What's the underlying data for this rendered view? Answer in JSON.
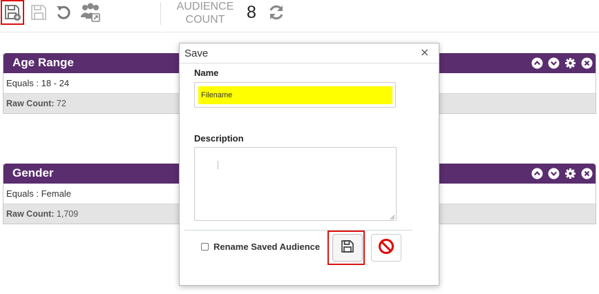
{
  "toolbar": {
    "audience_label": "AUDIENCE\nCOUNT",
    "audience_count": "8"
  },
  "panels": [
    {
      "title": "Age Range",
      "criteria": "Equals : 18 - 24",
      "raw_label": "Raw Count:",
      "raw_value": "72"
    },
    {
      "title": "Gender",
      "criteria": "Equals : Female",
      "raw_label": "Raw Count:",
      "raw_value": "1,709"
    }
  ],
  "dialog": {
    "title": "Save",
    "close_glyph": "×",
    "name_label": "Name",
    "name_value": "Filename",
    "description_label": "Description",
    "description_value": "",
    "rename_label": "Rename Saved Audience"
  },
  "colors": {
    "panel_header": "#5a2d6e",
    "highlight": "#dd1111",
    "name_field_bg": "#ffff00",
    "cancel_red": "#e00000"
  },
  "icons": {
    "save_as": "save-as-icon",
    "save": "save-icon",
    "undo": "undo-icon",
    "share_audience": "share-audience-icon",
    "refresh": "refresh-icon",
    "panel_up": "chevron-up-icon",
    "panel_down": "chevron-down-icon",
    "panel_settings": "gear-icon",
    "panel_close": "close-icon",
    "cancel": "cancel-icon"
  }
}
